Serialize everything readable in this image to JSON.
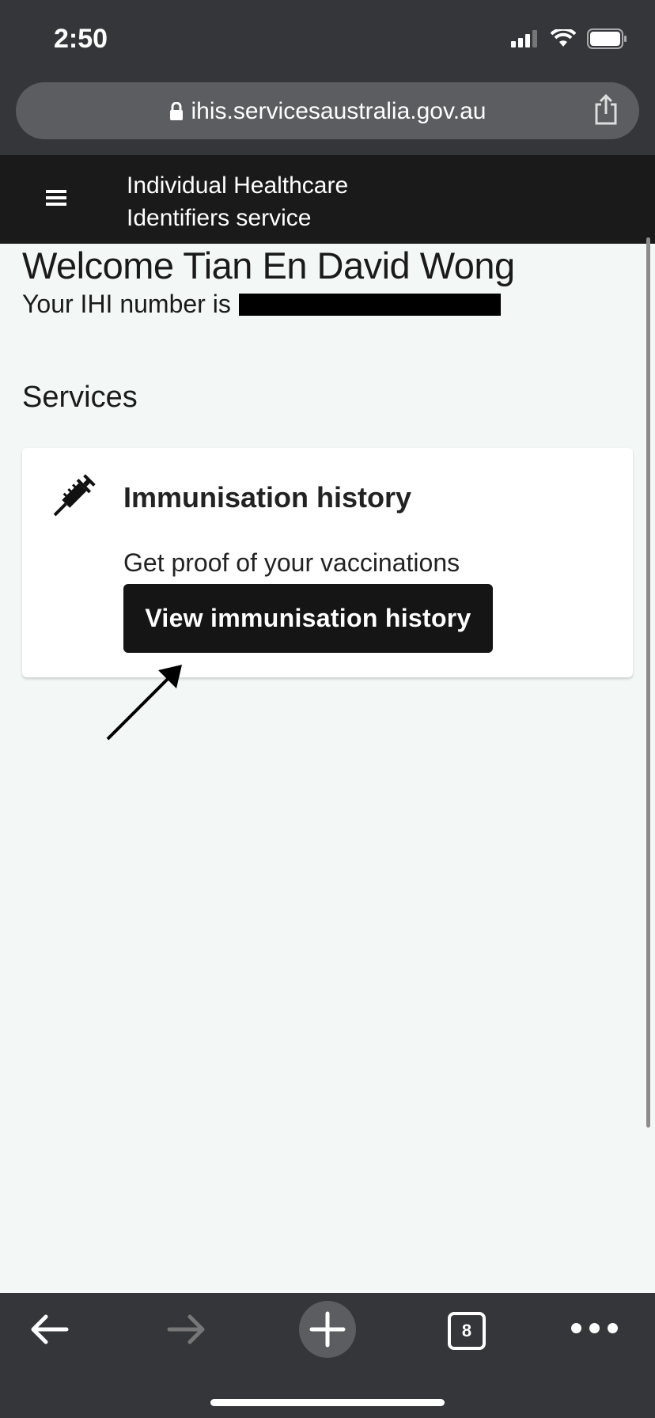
{
  "status_bar": {
    "time": "2:50"
  },
  "browser": {
    "url": "ihis.servicesaustralia.gov.au",
    "open_tabs": "8"
  },
  "header": {
    "title_line1": "Individual Healthcare",
    "title_line2": "Identifiers service"
  },
  "main": {
    "welcome": "Welcome Tian En David Wong",
    "ihi_label": "Your IHI number is",
    "services_heading": "Services",
    "card": {
      "title": "Immunisation history",
      "description": "Get proof of your vaccinations",
      "button_label": "View immunisation history"
    }
  },
  "colors": {
    "header_bg": "#1a1a1a",
    "browser_chrome": "#35363a",
    "page_bg": "#f3f7f6",
    "button_bg": "#151515"
  },
  "icons": [
    "lock-icon",
    "share-icon",
    "menu-icon",
    "syringe-icon",
    "back-arrow-icon",
    "forward-arrow-icon",
    "plus-icon",
    "tabs-icon",
    "more-icon",
    "annotation-arrow-icon"
  ]
}
